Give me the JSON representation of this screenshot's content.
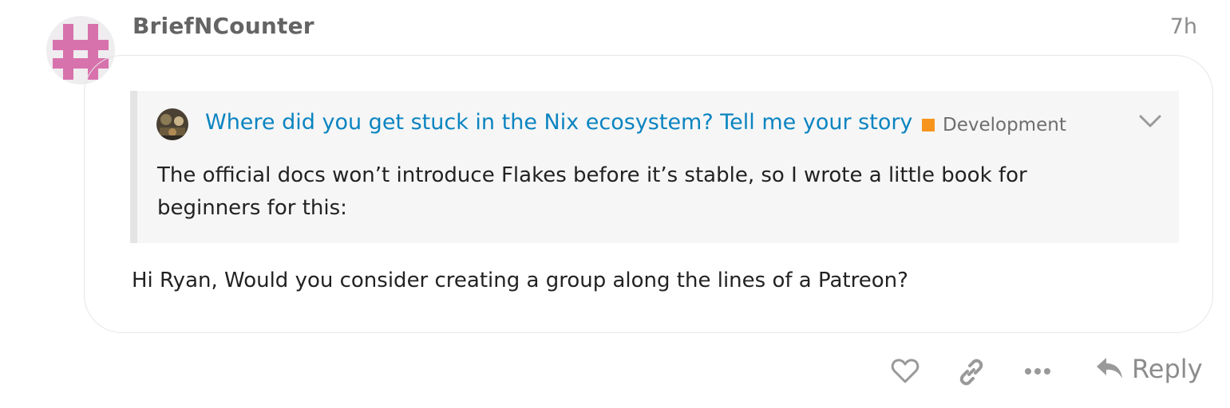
{
  "post": {
    "username": "BriefNCounter",
    "date": "7h",
    "avatar_color": "#d872ad",
    "body": "Hi Ryan, Would you consider creating a group along the lines of a Patreon?"
  },
  "quote": {
    "title": "Where did you get stuck in the Nix ecosystem? Tell me your story",
    "category": "Development",
    "category_color": "#f7941d",
    "text": "The official docs won’t introduce Flakes before it’s stable, so I wrote a little book for beginners for this:",
    "toggle_icon": "chevron-down-icon"
  },
  "actions": {
    "like_icon": "heart-icon",
    "link_icon": "link-icon",
    "more_icon": "ellipsis-icon",
    "reply_icon": "reply-arrow-icon",
    "reply_label": "Reply"
  }
}
